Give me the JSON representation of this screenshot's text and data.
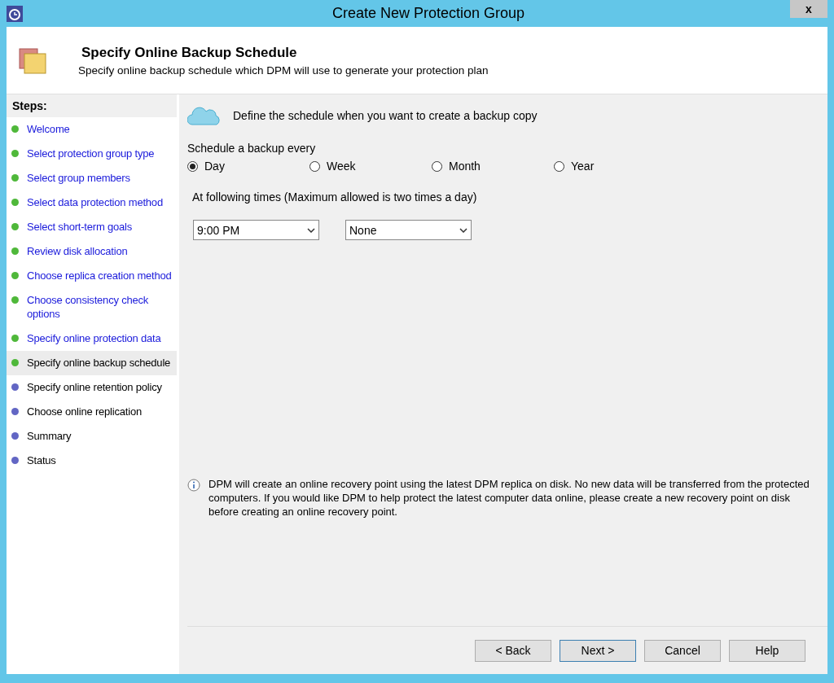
{
  "window": {
    "title": "Create New Protection Group",
    "close": "x"
  },
  "header": {
    "title": "Specify Online Backup Schedule",
    "subtitle": "Specify online backup schedule which DPM will use to generate your protection plan"
  },
  "steps": {
    "heading": "Steps:",
    "items": [
      {
        "label": "Welcome",
        "completed": true,
        "selected": false
      },
      {
        "label": "Select protection group type",
        "completed": true,
        "selected": false
      },
      {
        "label": "Select group members",
        "completed": true,
        "selected": false
      },
      {
        "label": "Select data protection method",
        "completed": true,
        "selected": false
      },
      {
        "label": "Select short-term goals",
        "completed": true,
        "selected": false
      },
      {
        "label": "Review disk allocation",
        "completed": true,
        "selected": false
      },
      {
        "label": "Choose replica creation method",
        "completed": true,
        "selected": false
      },
      {
        "label": "Choose consistency check options",
        "completed": true,
        "selected": false
      },
      {
        "label": "Specify online protection data",
        "completed": true,
        "selected": false
      },
      {
        "label": "Specify online backup schedule",
        "completed": true,
        "selected": true
      },
      {
        "label": "Specify online retention policy",
        "completed": false,
        "selected": false
      },
      {
        "label": "Choose online replication",
        "completed": false,
        "selected": false
      },
      {
        "label": "Summary",
        "completed": false,
        "selected": false
      },
      {
        "label": "Status",
        "completed": false,
        "selected": false
      }
    ]
  },
  "main": {
    "intro": "Define the schedule when you want to create a backup copy",
    "frequency_label": "Schedule a backup every",
    "frequency": [
      {
        "label": "Day",
        "selected": true
      },
      {
        "label": "Week",
        "selected": false
      },
      {
        "label": "Month",
        "selected": false
      },
      {
        "label": "Year",
        "selected": false
      }
    ],
    "times_label": "At following times (Maximum allowed is two times a day)",
    "times": [
      {
        "value": "9:00 PM"
      },
      {
        "value": "None"
      }
    ],
    "info": "DPM will create an online recovery point using the latest DPM replica on disk. No new data will be transferred from the protected computers. If you would like DPM to help protect the latest computer data online, please create a new recovery point on disk before creating an online recovery point."
  },
  "buttons": [
    {
      "label": "< Back",
      "default": false
    },
    {
      "label": "Next >",
      "default": true
    },
    {
      "label": "Cancel",
      "default": false
    },
    {
      "label": "Help",
      "default": false
    }
  ]
}
